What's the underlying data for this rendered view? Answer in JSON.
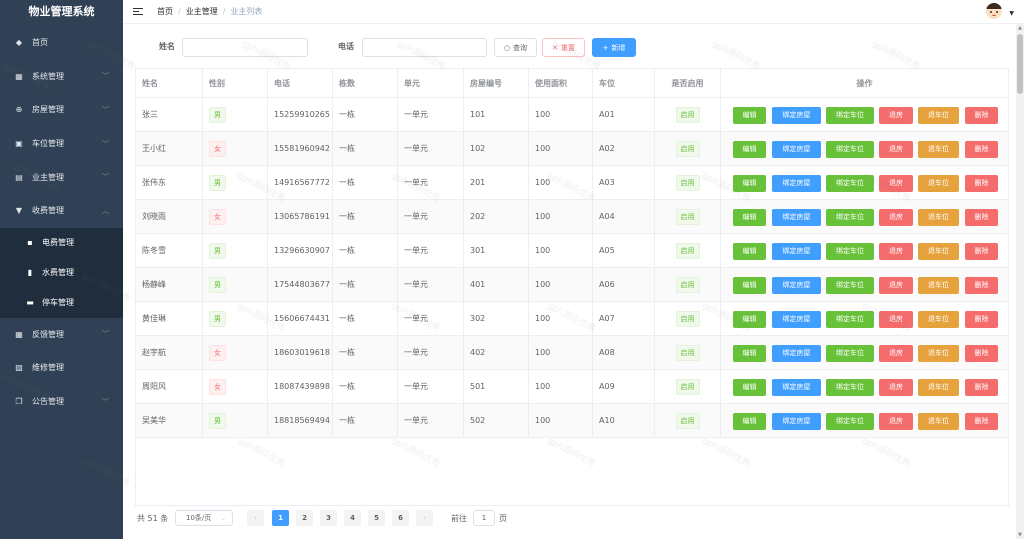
{
  "app": {
    "title": "物业管理系统"
  },
  "sidebar": {
    "items": [
      {
        "label": "首页",
        "icon": "dashboard-icon",
        "glyph": "◆",
        "has_children": false
      },
      {
        "label": "系统管理",
        "icon": "grid-icon",
        "glyph": "▦",
        "has_children": true
      },
      {
        "label": "房屋管理",
        "icon": "plus-circle-icon",
        "glyph": "⊕",
        "has_children": true
      },
      {
        "label": "车位管理",
        "icon": "car-icon",
        "glyph": "▣",
        "has_children": true
      },
      {
        "label": "业主管理",
        "icon": "table-icon",
        "glyph": "▤",
        "has_children": true
      },
      {
        "label": "收费管理",
        "icon": "bookmark-icon",
        "glyph": "▼",
        "has_children": true,
        "expanded": true
      }
    ],
    "sub_items": [
      {
        "label": "电费管理",
        "icon": "image-icon",
        "glyph": "▪"
      },
      {
        "label": "水费管理",
        "icon": "bar-chart-icon",
        "glyph": "▮"
      },
      {
        "label": "停车管理",
        "icon": "document-icon",
        "glyph": "▬"
      }
    ],
    "more_items": [
      {
        "label": "反馈管理",
        "icon": "calendar-icon",
        "glyph": "▦",
        "has_children": true
      },
      {
        "label": "维修管理",
        "icon": "picture-icon",
        "glyph": "▨",
        "has_children": false
      },
      {
        "label": "公告管理",
        "icon": "copy-icon",
        "glyph": "❐",
        "has_children": true
      }
    ]
  },
  "header": {
    "breadcrumb": [
      "首页",
      "业主管理",
      "业主列表"
    ]
  },
  "search": {
    "name_label": "姓名",
    "name_value": "",
    "phone_label": "电话",
    "phone_value": "",
    "query_label": "查询",
    "reset_label": "重置",
    "add_label": "新增"
  },
  "table": {
    "columns": [
      "姓名",
      "性别",
      "电话",
      "栋数",
      "单元",
      "房屋编号",
      "使用面积",
      "车位",
      "是否启用",
      "操作"
    ],
    "action_labels": [
      "编辑",
      "绑定房屋",
      "绑定车位",
      "退房",
      "退车位",
      "删除"
    ],
    "rows": [
      {
        "name": "张三",
        "gender": "男",
        "phone": "15259910265",
        "building": "一栋",
        "unit": "一单元",
        "house_no": "101",
        "area": "100",
        "parking": "A01",
        "enabled": "启用"
      },
      {
        "name": "王小红",
        "gender": "女",
        "phone": "15581960942",
        "building": "一栋",
        "unit": "一单元",
        "house_no": "102",
        "area": "100",
        "parking": "A02",
        "enabled": "启用"
      },
      {
        "name": "张伟东",
        "gender": "男",
        "phone": "14916567772",
        "building": "一栋",
        "unit": "一单元",
        "house_no": "201",
        "area": "100",
        "parking": "A03",
        "enabled": "启用"
      },
      {
        "name": "刘晓雨",
        "gender": "女",
        "phone": "13065786191",
        "building": "一栋",
        "unit": "一单元",
        "house_no": "202",
        "area": "100",
        "parking": "A04",
        "enabled": "启用"
      },
      {
        "name": "陈冬雪",
        "gender": "男",
        "phone": "13296630907",
        "building": "一栋",
        "unit": "一单元",
        "house_no": "301",
        "area": "100",
        "parking": "A05",
        "enabled": "启用"
      },
      {
        "name": "杨静峰",
        "gender": "男",
        "phone": "17544803677",
        "building": "一栋",
        "unit": "一单元",
        "house_no": "401",
        "area": "100",
        "parking": "A06",
        "enabled": "启用"
      },
      {
        "name": "黄佳琳",
        "gender": "男",
        "phone": "15606674431",
        "building": "一栋",
        "unit": "一单元",
        "house_no": "302",
        "area": "100",
        "parking": "A07",
        "enabled": "启用"
      },
      {
        "name": "赵宇航",
        "gender": "女",
        "phone": "18603019618",
        "building": "一栋",
        "unit": "一单元",
        "house_no": "402",
        "area": "100",
        "parking": "A08",
        "enabled": "启用"
      },
      {
        "name": "周阳风",
        "gender": "女",
        "phone": "18087439898",
        "building": "一栋",
        "unit": "一单元",
        "house_no": "501",
        "area": "100",
        "parking": "A09",
        "enabled": "启用"
      },
      {
        "name": "吴美华",
        "gender": "男",
        "phone": "18818569494",
        "building": "一栋",
        "unit": "一单元",
        "house_no": "502",
        "area": "100",
        "parking": "A10",
        "enabled": "启用"
      }
    ]
  },
  "pagination": {
    "total_label": "共 51 条",
    "page_size_label": "10条/页",
    "pages": [
      "1",
      "2",
      "3",
      "4",
      "5",
      "6"
    ],
    "current_page": "1",
    "goto_label": "前往",
    "goto_value": "1",
    "page_suffix": "页",
    "prev_glyph": "‹",
    "next_glyph": "›"
  },
  "watermark": {
    "text": "gph源码优秀"
  },
  "colors": {
    "sidebar_bg": "#304156",
    "submenu_bg": "#1f2d3d",
    "primary": "#409eff",
    "success": "#67c23a",
    "danger": "#f56c6c",
    "warning": "#e6a23c"
  }
}
